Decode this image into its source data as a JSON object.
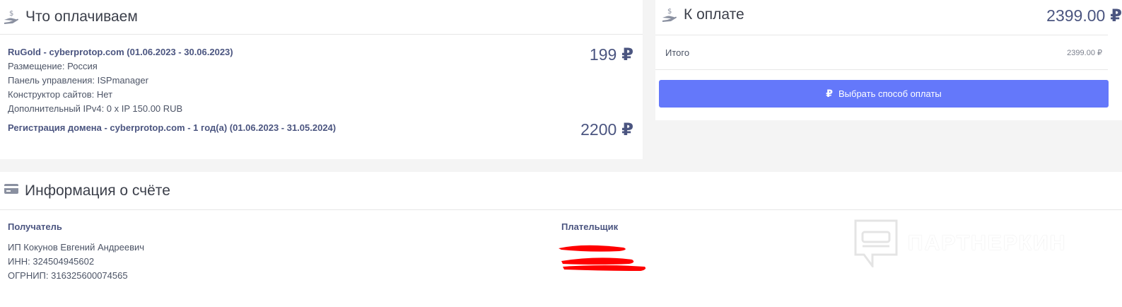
{
  "order": {
    "title": "Что оплачиваем",
    "icon": "hand-coin-icon",
    "items": [
      {
        "title": "RuGold - cyberprotop.com (01.06.2023 - 30.06.2023)",
        "details": [
          "Размещение: Россия",
          "Панель управления: ISPmanager",
          "Конструктор сайтов: Нет",
          "Дополнительный IPv4: 0 x IP 150.00 RUB"
        ],
        "price": "199",
        "currency": "₽"
      },
      {
        "title": "Регистрация домена - cyberprotop.com - 1 год(а) (01.06.2023 - 31.05.2024)",
        "details": [],
        "price": "2200",
        "currency": "₽"
      }
    ]
  },
  "payment": {
    "title": "К оплате",
    "icon": "hand-coin-icon",
    "total": "2399.00",
    "currency": "₽",
    "row_label": "Итого",
    "row_value": "2399.00 ₽",
    "button_label": "Выбрать способ оплаты",
    "button_icon": "ruble-icon",
    "button_color": "#6478fa"
  },
  "invoice": {
    "title": "Информация о счёте",
    "icon": "credit-card-icon",
    "recipient_label": "Получатель",
    "recipient_lines": [
      "ИП Кокунов Евгений Андреевич",
      "ИНН: 324504945602",
      "ОГРНИП: 316325600074565"
    ],
    "payer_label": "Плательщик"
  },
  "watermark": {
    "text": "ПАРТНЕРКИН"
  },
  "colors": {
    "accent": "#6478fa",
    "heading": "#4b5580",
    "redaction": "#ff0000"
  }
}
